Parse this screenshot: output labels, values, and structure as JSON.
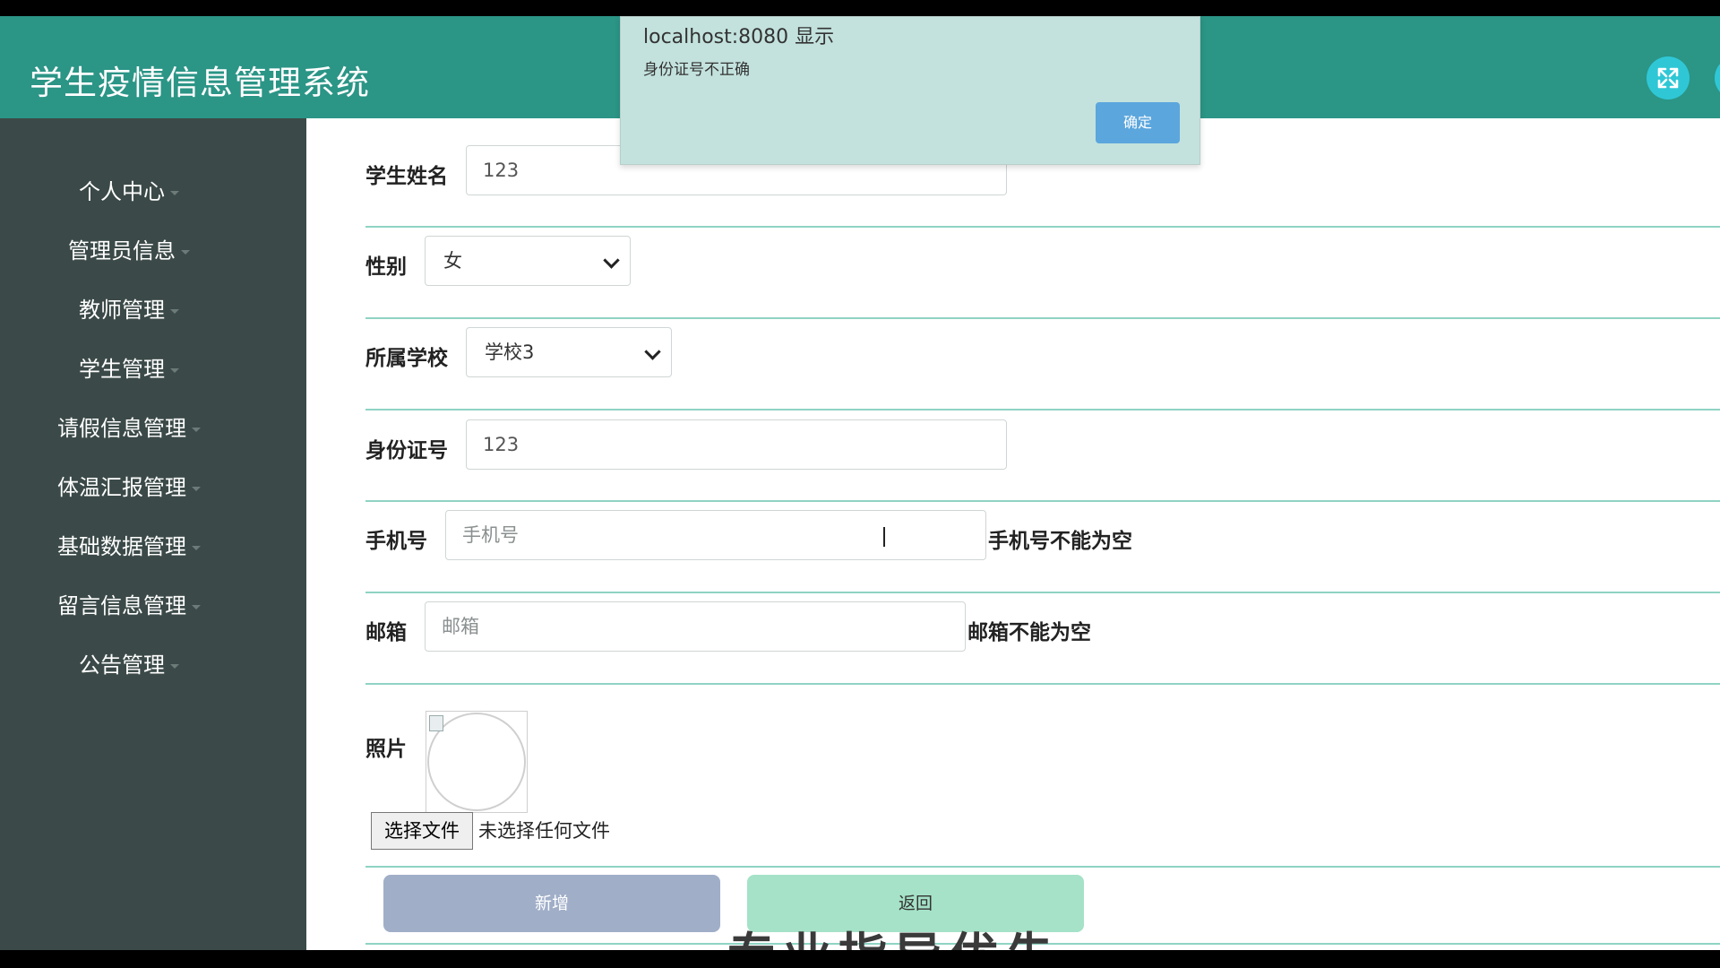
{
  "header": {
    "title": "学生疫情信息管理系统"
  },
  "sidebar": {
    "items": [
      {
        "label": "个人中心"
      },
      {
        "label": "管理员信息"
      },
      {
        "label": "教师管理"
      },
      {
        "label": "学生管理"
      },
      {
        "label": "请假信息管理"
      },
      {
        "label": "体温汇报管理"
      },
      {
        "label": "基础数据管理"
      },
      {
        "label": "留言信息管理"
      },
      {
        "label": "公告管理"
      }
    ]
  },
  "form": {
    "name": {
      "label": "学生姓名",
      "value": "123"
    },
    "gender": {
      "label": "性别",
      "value": "女"
    },
    "school": {
      "label": "所属学校",
      "value": "学校3"
    },
    "id_number": {
      "label": "身份证号",
      "value": "123"
    },
    "phone": {
      "label": "手机号",
      "placeholder": "手机号",
      "error": "手机号不能为空"
    },
    "email": {
      "label": "邮箱",
      "placeholder": "邮箱",
      "error": "邮箱不能为空"
    },
    "photo": {
      "label": "照片",
      "choose_file": "选择文件",
      "file_status": "未选择任何文件"
    },
    "submit_label": "新增",
    "back_label": "返回"
  },
  "dialog": {
    "title": "localhost:8080 显示",
    "message": "身份证号不正确",
    "ok_label": "确定"
  },
  "overlay_text": "专业指导优先",
  "colors": {
    "header": "#2b9586",
    "sidebar": "#3b4a48",
    "row_divider": "#8fd3c3",
    "submit_button": "#a0aec8",
    "back_button": "#a5e2c8",
    "dialog_button": "#5ba6dd"
  }
}
